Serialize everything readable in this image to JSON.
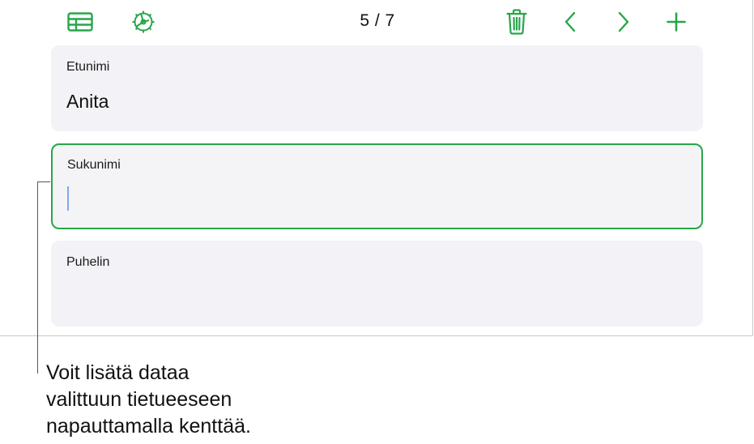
{
  "toolbar": {
    "record_counter": "5 / 7",
    "icons": {
      "table": "table-icon",
      "settings": "record-settings-icon",
      "delete": "trash-icon",
      "previous": "chevron-left-icon",
      "next": "chevron-right-icon",
      "add": "plus-icon"
    }
  },
  "fields": [
    {
      "label": "Etunimi",
      "value": "Anita",
      "selected": false
    },
    {
      "label": "Sukunimi",
      "value": "",
      "selected": true
    },
    {
      "label": "Puhelin",
      "value": "",
      "selected": false
    }
  ],
  "callout": {
    "lines": [
      "Voit lisätä dataa",
      "valittuun tietueeseen",
      "napauttamalla kenttää."
    ]
  },
  "colors": {
    "accent": "#27a64a",
    "field_background": "#f2f2f7",
    "caret": "#7fa8e6"
  }
}
